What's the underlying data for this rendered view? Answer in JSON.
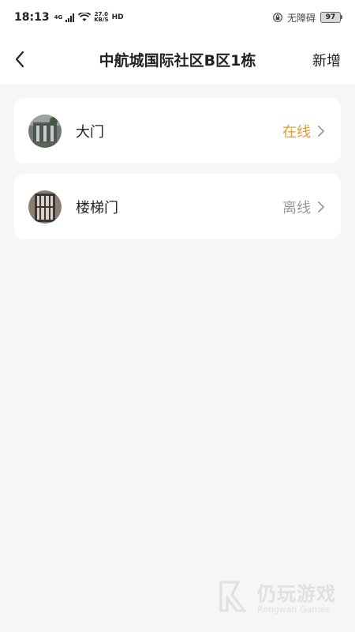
{
  "status_bar": {
    "time": "18:13",
    "network_label": "4G",
    "speed_value": "27.0",
    "speed_unit": "KB/S",
    "hd_label": "HD",
    "accessibility_label": "无障碍",
    "battery_level": "97"
  },
  "header": {
    "title": "中航城国际社区B区1栋",
    "add_label": "新增"
  },
  "devices": [
    {
      "name": "大门",
      "status": "在线",
      "status_color": "#e59a2d"
    },
    {
      "name": "楼梯门",
      "status": "离线",
      "status_color": "#999999"
    }
  ],
  "watermark": {
    "cn": "仍玩游戏",
    "en": "Rengwan Games"
  }
}
